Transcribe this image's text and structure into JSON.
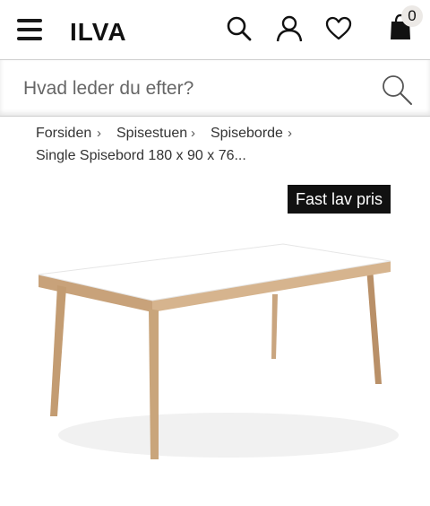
{
  "header": {
    "logo_text": "ILVA",
    "menu_icon": "hamburger-menu-icon",
    "search_icon": "search-icon",
    "account_icon": "user-icon",
    "wishlist_icon": "heart-icon",
    "cart_icon": "shopping-bag-icon",
    "cart_count": "0"
  },
  "search": {
    "placeholder": "Hvad leder du efter?"
  },
  "breadcrumb": {
    "items": [
      "Forsiden",
      "Spisestuen",
      "Spiseborde"
    ],
    "separator": "›",
    "current": "Single Spisebord 180 x 90 x 76..."
  },
  "product": {
    "badge": "Fast lav pris",
    "image_description": "dining-table-image"
  },
  "colors": {
    "badge_bg": "#111111",
    "badge_text": "#ffffff",
    "table_top": "#ffffff",
    "table_wood": "#c8a27a"
  }
}
